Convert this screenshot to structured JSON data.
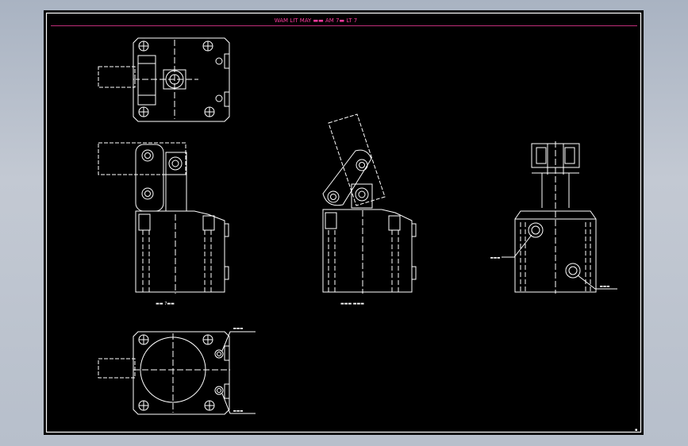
{
  "drawing": {
    "title": "WAM LIT MAY  ▬▬ AM 7▬ LT 7",
    "view_label_front": "▬▬ 7▬▬",
    "view_label_open": "▬▬▬ ▬▬▬",
    "port_label_left": "▬▬▬",
    "port_label_right": "▬▬▬",
    "port_label_top": "▬▬▬",
    "port_label_bottom": "▬▬▬",
    "sheet_mark": "▪"
  },
  "colors": {
    "background": "#000000",
    "line": "#ffffff",
    "title": "#ff3ca0",
    "title_rule": "#ff3ca0"
  }
}
